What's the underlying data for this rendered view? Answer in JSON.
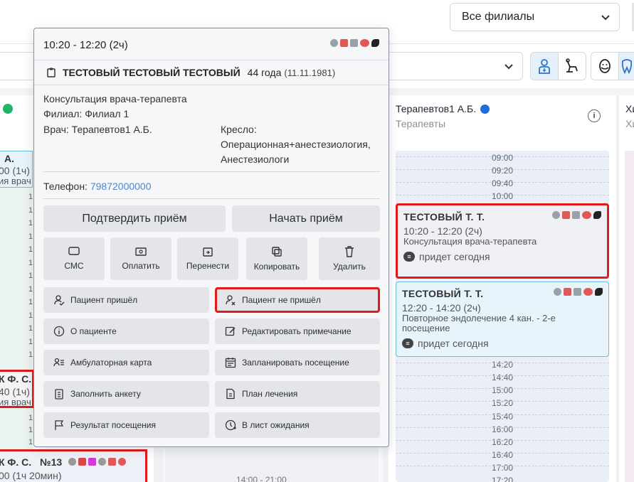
{
  "topbar": {
    "branch_select": "Все филиалы"
  },
  "doctor_column": {
    "name": "Терапевтов1 А.Б.",
    "specialty": "Терапевты",
    "next_col_name": "Хи",
    "next_col_sub": "Хи"
  },
  "schedule": {
    "top_slots": [
      "09:00",
      "09:20",
      "09:40",
      "10:00"
    ],
    "bottom_slots": [
      "14:20",
      "14:40",
      "15:00",
      "15:20",
      "15:40",
      "16:00",
      "16:20",
      "16:40",
      "17:00",
      "17:20"
    ],
    "break_label": "14:00 - 21:00"
  },
  "appointments": [
    {
      "name": "ТЕСТОВЫЙ Т. Т.",
      "time": "10:20 - 12:20 (2ч)",
      "service": "Консультация врача-терапевта",
      "status": "придет сегодня"
    },
    {
      "name": "ТЕСТОВЫЙ Т. Т.",
      "time": "12:20 - 14:20 (2ч)",
      "service": "Повторное эндолечение 4 кан. - 2-е посещение",
      "status": "придет сегодня"
    }
  ],
  "left_column": {
    "appt1_line1": "А.",
    "appt1_line2": "00 (1ч)",
    "appt1_line3": "ия врач",
    "appt2_line1": "К Ф. С.",
    "appt2_line2": "40 (1ч)",
    "appt2_line3": "ия врач",
    "appt3_line1": "К Ф. С.",
    "appt3_number": "№13",
    "appt3_line2": "00 (1ч 20мин)"
  },
  "popup": {
    "time": "10:20 - 12:20 (2ч)",
    "patient_name": "ТЕСТОВЫЙ ТЕСТОВЫЙ ТЕСТОВЫЙ",
    "age": "44 года",
    "dob": "(11.11.1981)",
    "service": "Консультация врача-терапевта",
    "branch": "Филиал: Филиал 1",
    "doctor": "Врач: Терапевтов1 А.Б.",
    "chair_label": "Кресло:",
    "chair_line1": "Операционная+анестезиология,",
    "chair_line2": "Анестезиологи",
    "phone_label": "Телефон:",
    "phone": "79872000000",
    "confirm_button": "Подтвердить приём",
    "start_button": "Начать приём",
    "small_buttons": [
      "СМС",
      "Оплатить",
      "Перенести",
      "Копировать",
      "Удалить"
    ],
    "actions_left": [
      "Пациент пришёл",
      "О пациенте",
      "Амбулаторная карта",
      "Заполнить анкету",
      "Результат посещения"
    ],
    "actions_right": [
      "Пациент не пришёл",
      "Редактировать примечание",
      "Запланировать посещение",
      "План лечения",
      "В лист ожидания"
    ]
  },
  "colors": {
    "highlight": "#e01b1b",
    "link": "#4d86c9",
    "doctor_dot": "#1e6fd9"
  }
}
